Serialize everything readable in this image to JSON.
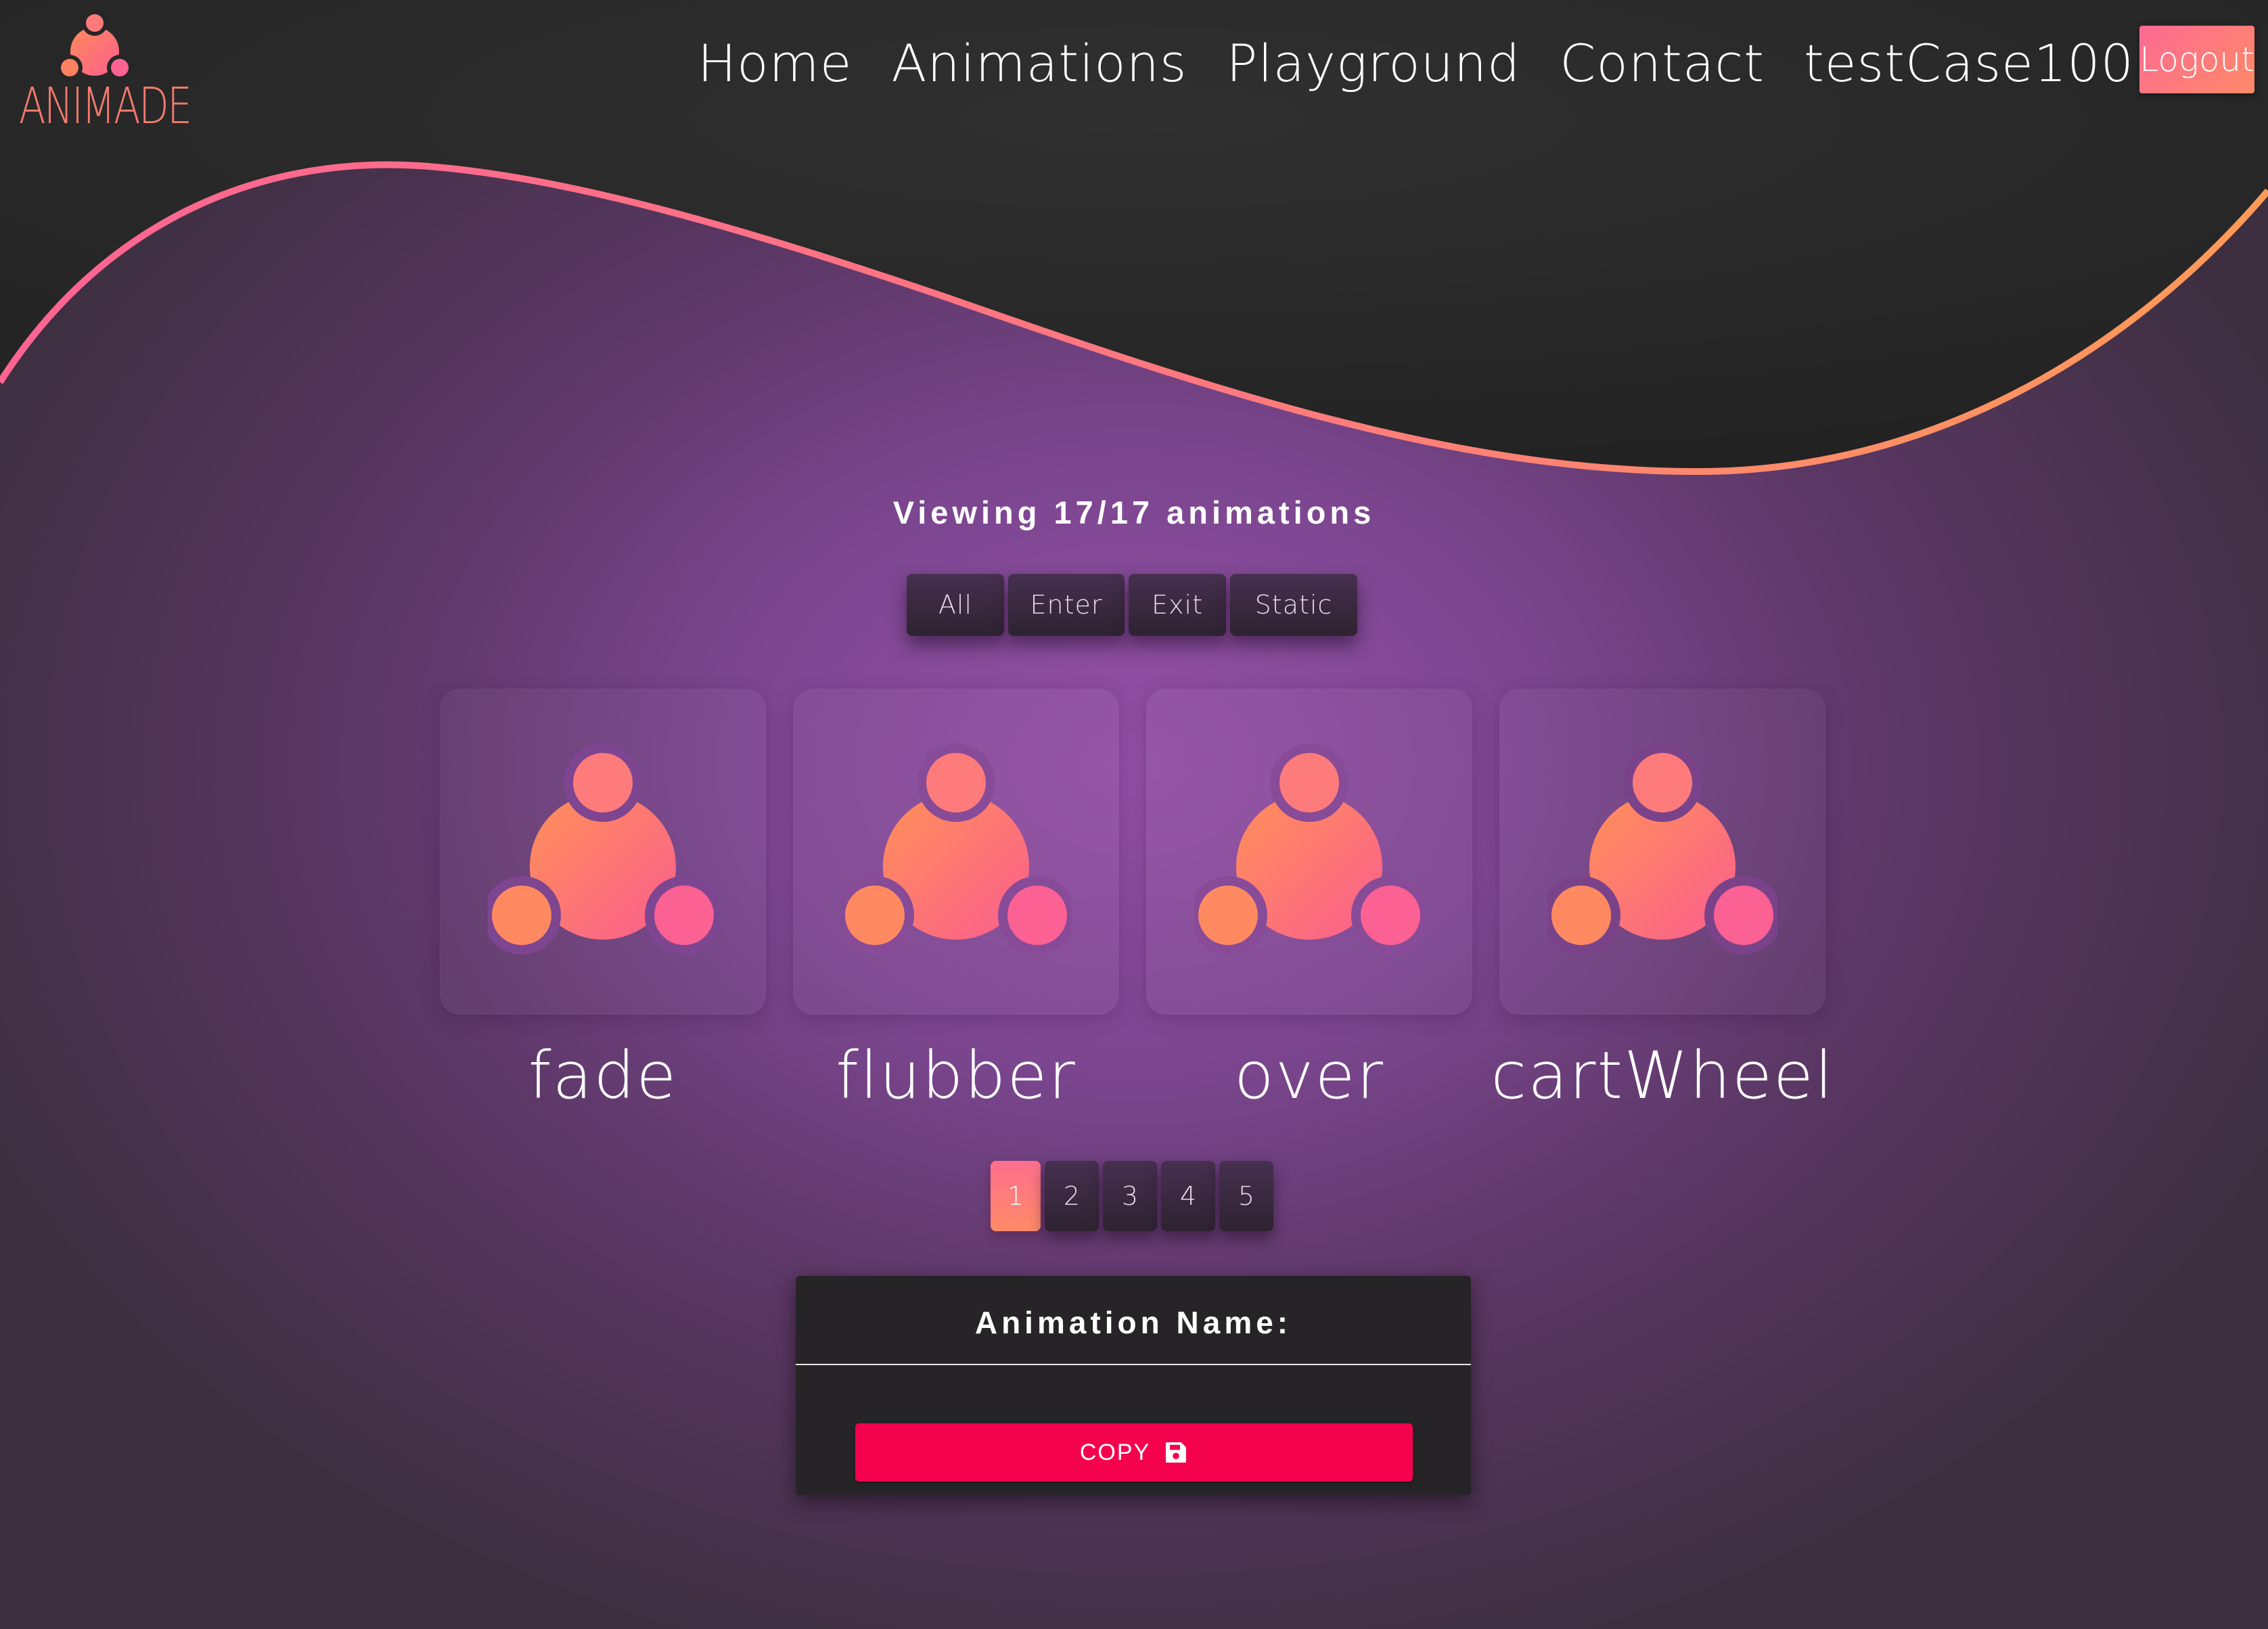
{
  "brand": {
    "logo_text": "ANIMADE"
  },
  "nav": {
    "items": [
      "Home",
      "Animations",
      "Playground",
      "Contact",
      "testCase100"
    ],
    "logout_label": "Logout"
  },
  "main": {
    "viewing_text": "Viewing 17/17 animations",
    "filters": [
      "All",
      "Enter",
      "Exit",
      "Static"
    ],
    "cards": [
      {
        "label": "fade",
        "icon": "animade-logo-icon"
      },
      {
        "label": "flubber",
        "icon": "animade-logo-icon"
      },
      {
        "label": "over",
        "icon": "animade-logo-icon"
      },
      {
        "label": "cartWheel",
        "icon": "animade-logo-icon"
      }
    ],
    "pages": [
      "1",
      "2",
      "3",
      "4",
      "5"
    ],
    "active_page": "1"
  },
  "panel": {
    "title": "Animation Name:",
    "copy_label": "COPY",
    "copy_icon": "floppy-disk-icon"
  },
  "colors": {
    "accent_start": "#fd6a93",
    "accent_end": "#ff8a67",
    "copy_button": "#f5024e",
    "header_bg": "#262626",
    "purple_center": "#9450a6"
  }
}
